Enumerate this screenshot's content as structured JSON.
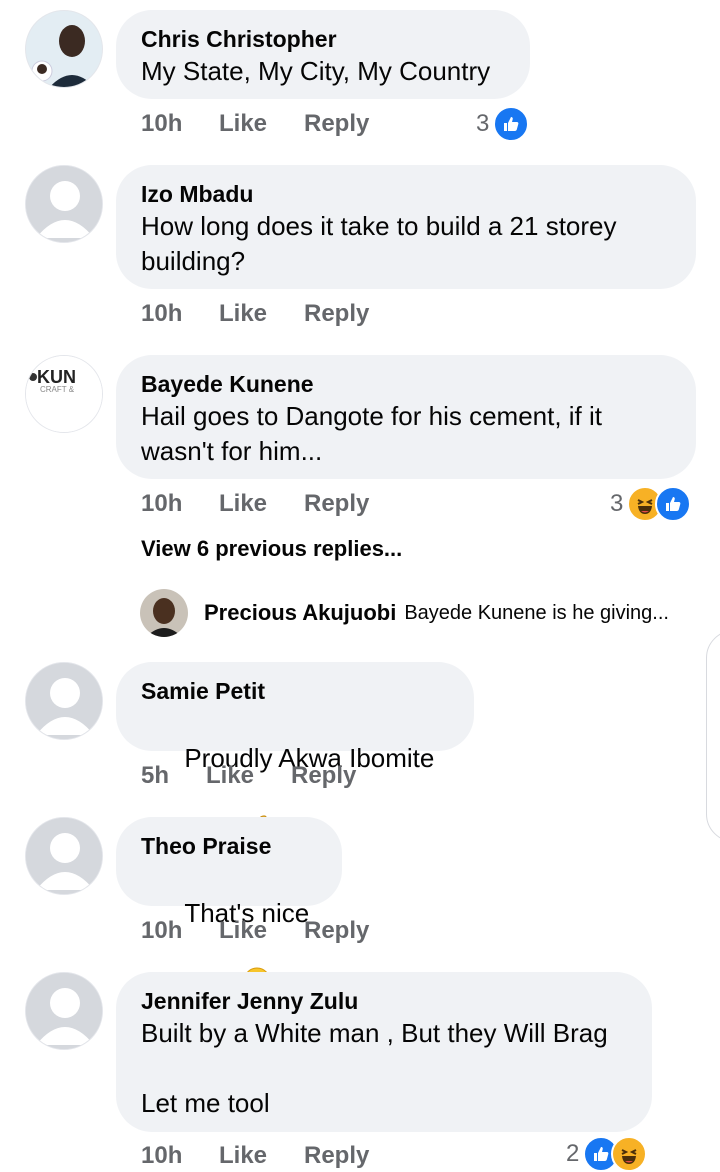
{
  "comments": [
    {
      "name": "Chris Christopher",
      "text": "My State, My City, My Country",
      "time": "10h",
      "like": "Like",
      "reply": "Reply",
      "reaction_count": "3",
      "reaction_icons": [
        "like-icon"
      ]
    },
    {
      "name": "Izo Mbadu",
      "text": "How long does it take to build a 21 storey building?",
      "time": "10h",
      "like": "Like",
      "reply": "Reply"
    },
    {
      "name": "Bayede Kunene",
      "text": "Hail goes to Dangote for his cement, if it wasn't for him...",
      "time": "10h",
      "like": "Like",
      "reply": "Reply",
      "reaction_count": "3",
      "reaction_icons": [
        "haha-icon",
        "like-icon"
      ],
      "avatar_logo_text": "KUN",
      "avatar_logo_subtext": "CRAFT &",
      "view_replies": "View 6 previous replies...",
      "reply_preview": {
        "name": "Precious Akujuobi",
        "text": "Bayede Kunene is he giving..."
      }
    },
    {
      "name": "Samie Petit",
      "text": "Proudly Akwa Ibomite",
      "emoji": "flexed-biceps",
      "time": "5h",
      "like": "Like",
      "reply": "Reply"
    },
    {
      "name": "Theo Praise",
      "text": "That's nice",
      "emoji": "smiling-face",
      "time": "10h",
      "like": "Like",
      "reply": "Reply"
    },
    {
      "name": "Jennifer Jenny Zulu",
      "text": "Built by a White man , But they Will Brag\n\nLet me tool",
      "time": "10h",
      "like": "Like",
      "reply": "Reply",
      "reaction_count": "2",
      "reaction_icons": [
        "like-icon",
        "haha-icon"
      ]
    }
  ],
  "colors": {
    "bubble": "#f0f2f5",
    "meta": "#65676b",
    "like_blue": "#1877f2",
    "haha_yellow": "#f7b125"
  }
}
